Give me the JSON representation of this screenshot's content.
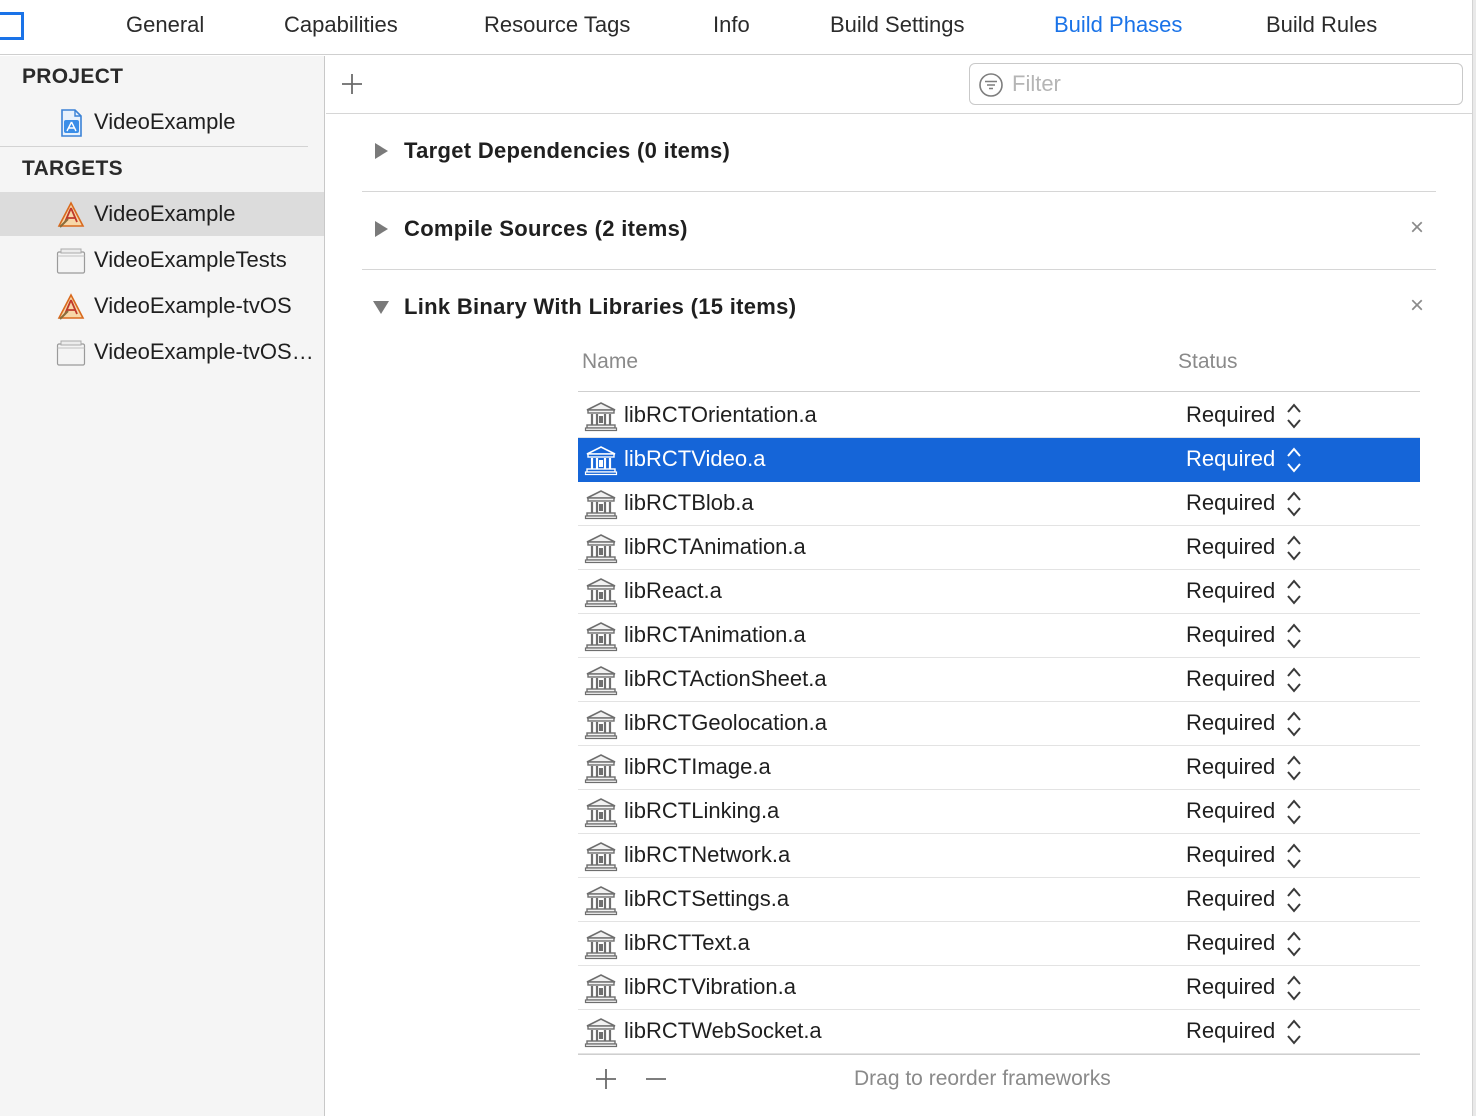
{
  "tabs": [
    {
      "label": "General",
      "active": false
    },
    {
      "label": "Capabilities",
      "active": false
    },
    {
      "label": "Resource Tags",
      "active": false
    },
    {
      "label": "Info",
      "active": false
    },
    {
      "label": "Build Settings",
      "active": false
    },
    {
      "label": "Build Phases",
      "active": true
    },
    {
      "label": "Build Rules",
      "active": false
    }
  ],
  "sidebar": {
    "project_header": "PROJECT",
    "project_items": [
      {
        "label": "VideoExample",
        "icon": "xcode-project-icon"
      }
    ],
    "targets_header": "TARGETS",
    "target_items": [
      {
        "label": "VideoExample",
        "icon": "app-target-icon",
        "selected": true
      },
      {
        "label": "VideoExampleTests",
        "icon": "test-bundle-icon",
        "selected": false
      },
      {
        "label": "VideoExample-tvOS",
        "icon": "app-target-icon",
        "selected": false
      },
      {
        "label": "VideoExample-tvOS…",
        "icon": "test-bundle-icon",
        "selected": false
      }
    ]
  },
  "toolbar": {
    "add_icon": "plus-icon",
    "filter_placeholder": "Filter",
    "filter_icon": "filter-icon"
  },
  "phases": [
    {
      "title": "Target Dependencies (0 items)",
      "expanded": false,
      "removable": false
    },
    {
      "title": "Compile Sources (2 items)",
      "expanded": false,
      "removable": true
    },
    {
      "title": "Link Binary With Libraries (15 items)",
      "expanded": true,
      "removable": true
    }
  ],
  "close_glyph": "×",
  "libraries": {
    "col_name": "Name",
    "col_status": "Status",
    "rows": [
      {
        "name": "libRCTOrientation.a",
        "status": "Required",
        "selected": false
      },
      {
        "name": "libRCTVideo.a",
        "status": "Required",
        "selected": true
      },
      {
        "name": "libRCTBlob.a",
        "status": "Required",
        "selected": false
      },
      {
        "name": "libRCTAnimation.a",
        "status": "Required",
        "selected": false
      },
      {
        "name": "libReact.a",
        "status": "Required",
        "selected": false
      },
      {
        "name": "libRCTAnimation.a",
        "status": "Required",
        "selected": false
      },
      {
        "name": "libRCTActionSheet.a",
        "status": "Required",
        "selected": false
      },
      {
        "name": "libRCTGeolocation.a",
        "status": "Required",
        "selected": false
      },
      {
        "name": "libRCTImage.a",
        "status": "Required",
        "selected": false
      },
      {
        "name": "libRCTLinking.a",
        "status": "Required",
        "selected": false
      },
      {
        "name": "libRCTNetwork.a",
        "status": "Required",
        "selected": false
      },
      {
        "name": "libRCTSettings.a",
        "status": "Required",
        "selected": false
      },
      {
        "name": "libRCTText.a",
        "status": "Required",
        "selected": false
      },
      {
        "name": "libRCTVibration.a",
        "status": "Required",
        "selected": false
      },
      {
        "name": "libRCTWebSocket.a",
        "status": "Required",
        "selected": false
      }
    ],
    "footer_hint": "Drag to reorder frameworks"
  },
  "colors": {
    "accent": "#1a73e8",
    "selection": "#1565d8",
    "sidebar_bg": "#f5f5f5"
  }
}
